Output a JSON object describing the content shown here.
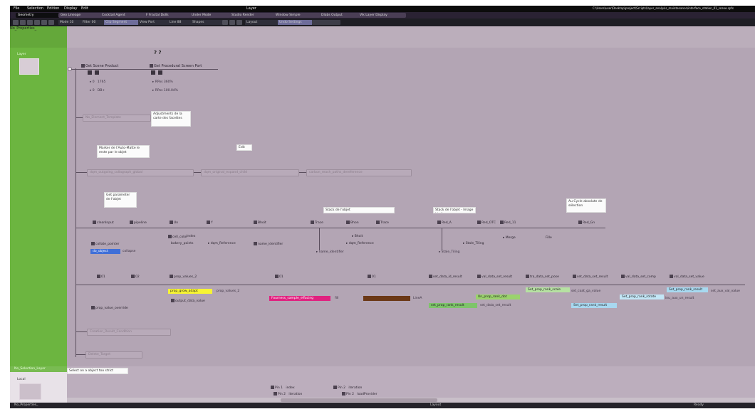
{
  "menu": {
    "items": [
      "File",
      "Selection",
      "Edition",
      "Display",
      "Edit"
    ],
    "title": "Layer",
    "path": "C:\\Users\\user\\Desktop\\project\\Scripts\\layer_analysis_maintenance\\interface_station_01_scene.cpfs"
  },
  "tabs": [
    "Geometry",
    "Geo Lineage",
    "Cocktail Agent",
    "F Fractal Dolls",
    "Under Mode",
    "Studio Render",
    "Window Simple",
    "Dlabs Output",
    "Vik Layer Display"
  ],
  "toolbar": {
    "labels": [
      "Mode 10",
      "Filter 00",
      "Clip Segment",
      "View Port",
      "Line 88",
      "Shapes",
      "Layout",
      "Undo Settings"
    ]
  },
  "sidebar": {
    "header": "No_Properties_",
    "item": "Layer",
    "bottom_header": "No_Selection_Layer",
    "bottom_item": "Local"
  },
  "canvas": {
    "top_marks": "? ?",
    "root_nodes": [
      {
        "label": "Get Scene Product",
        "p1": "0",
        "p2": "1765",
        "p3": "0",
        "p4": "DB+"
      },
      {
        "label": "Get Procedural Screen Port",
        "p1": "0",
        "p2": "RPos",
        "p3": "360%",
        "p4": "RPos",
        "p5": "100.04%"
      }
    ],
    "branch_labels": [
      "No_Element_Template",
      "Creation_Result_Condition",
      "Delete_Target"
    ],
    "chain_a": [
      "dqm_outgoing_collagraph_global",
      "dqm_original_expand_child",
      "carbon_reach_paths_dereference"
    ],
    "notes": [
      "Adjustments de la carte des facettes",
      "Marker de l'Auto-Matte le reste par le objet",
      "Edit",
      "Get parameter de l'objet",
      "Stack de l'objet",
      "Stack de l'objet - Image Limit",
      "Au Cycle absolute de sélection"
    ],
    "row1_nodes": [
      "cleanInput",
      "pipeline",
      "Un",
      "Y",
      "Bhoit",
      "Trace",
      "Bhon",
      "Trace",
      "Red_A",
      "Red_OTC",
      "Red_11",
      "Red_Gn"
    ],
    "row1_sub": [
      "cell_color",
      "Index",
      "Bhoit",
      "Merge",
      "Fille"
    ],
    "row1_bottom": [
      "collate_pointer",
      "bakery_points",
      "dqm_Reference",
      "dqm_Reference",
      "name_identifier",
      "Stale_Tiling"
    ],
    "row1_blue_pill": "do_object",
    "row1_blue_sub": "collapse",
    "row2_nodes": [
      "01",
      "02",
      "prop_values_2",
      "01",
      "01",
      "set_data_id_result",
      "val_data_set_result",
      "tra_data_set_pose",
      "set_data_set_result",
      "val_data_set_comp",
      "val_data_set_value"
    ],
    "row2_pills": [
      {
        "text": "prop_grow_adapt",
        "color": "#f7f433"
      },
      {
        "text": "Fourness_sample_effacing",
        "color": "#e0217f"
      },
      {
        "text": "",
        "color": "#6b3816"
      },
      {
        "text": "set_prop_rank_result",
        "color": "#7ec46a"
      },
      {
        "text": "Un_prop_rank_dot",
        "color": "#9ad36c"
      },
      {
        "text": "Set_prop_rank_scale",
        "color": "#b6e2a2"
      },
      {
        "text": "Set_prop_rank_result",
        "color": "#a8d8f0"
      },
      {
        "text": "Set_prop_rank_rotate",
        "color": "#c2e6f6"
      }
    ],
    "row2_side": [
      "prop_values_2",
      "fill",
      "LineA",
      "set_data_set_result",
      "set_coat_ga_value",
      "inu_aux_un_result",
      "set_aux_val_value"
    ],
    "row2_sub": [
      "output_data_value",
      "prop_value_override"
    ],
    "bottom_note": "Select on a object too strict",
    "bottom_ports": [
      {
        "a": "Pin 1",
        "b": "index"
      },
      {
        "a": "Pin 2",
        "b": "iteration"
      },
      {
        "a": "Pin 2",
        "b": "iteration"
      },
      {
        "a": "Pin 2",
        "b": "loadProvider"
      }
    ]
  },
  "status": {
    "left": "No_Properties_",
    "center": "Layout",
    "right": "Ready"
  }
}
